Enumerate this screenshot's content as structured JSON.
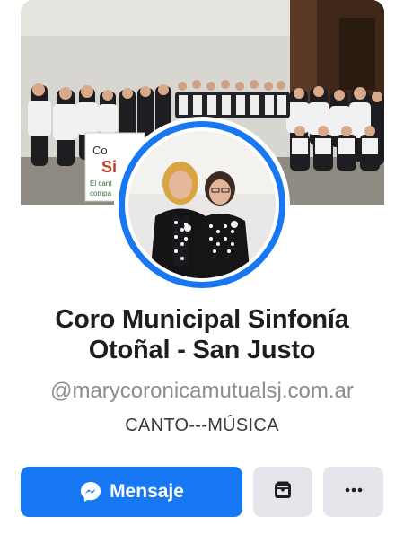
{
  "profile": {
    "name_line1": "Coro Municipal Sinfonía",
    "name_line2": "Otoñal - San Justo",
    "handle": "@marycoronicamutualsj.com.ar",
    "category": "CANTO---MÚSICA"
  },
  "actions": {
    "message_label": "Mensaje",
    "message_icon": "messenger-icon",
    "save_icon": "bookmark-box-icon",
    "more_icon": "more-dots-icon"
  },
  "banner": {
    "line1": "Co",
    "line2": "Si",
    "line3": "El cant",
    "line4": "compa"
  },
  "colors": {
    "primary": "#1877f2",
    "secondary_button": "#e4e6eb",
    "text_dark": "#1c1e21",
    "text_muted": "#8a8d91"
  }
}
